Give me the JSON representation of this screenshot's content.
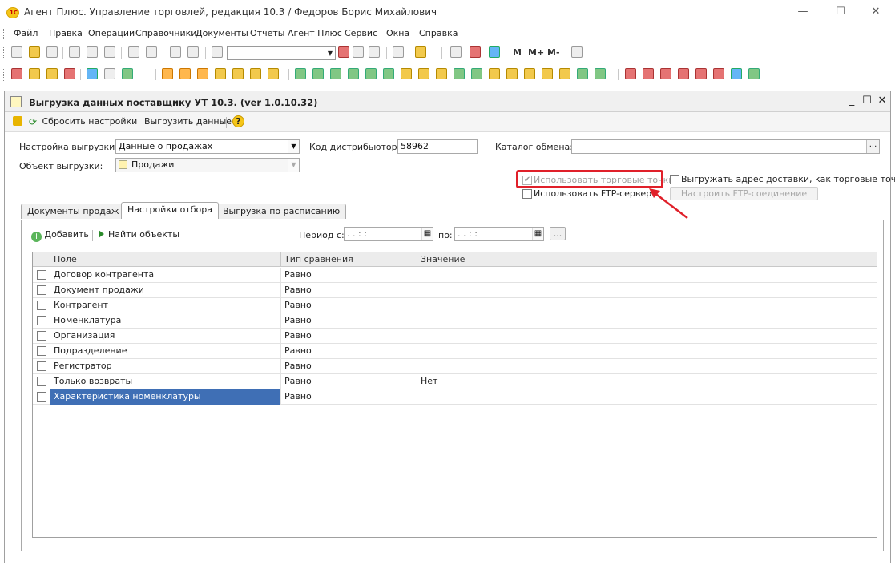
{
  "window": {
    "logo_text": "1С",
    "title": "Агент Плюс. Управление торговлей, редакция 10.3 / Федоров Борис Михайлович",
    "minimize": "—",
    "maximize": "☐",
    "close": "✕"
  },
  "menu": {
    "items": [
      "Файл",
      "Правка",
      "Операции",
      "Справочники",
      "Документы",
      "Отчеты",
      "Агент Плюс",
      "Сервис",
      "Окна",
      "Справка"
    ]
  },
  "toolbar": {
    "m_label": "M",
    "m_plus_label": "M+",
    "m_minus_label": "M-"
  },
  "document": {
    "title": "Выгрузка данных поставщику УТ 10.3. (ver 1.0.10.32)",
    "win_min": "_",
    "win_max": "☐",
    "win_close": "✕",
    "commands": {
      "reset": "Сбросить настройки",
      "export": "Выгрузить данные",
      "help": "?"
    },
    "settings_label": "Настройка выгрузки:",
    "settings_value": "Данные о продажах",
    "distributor_code_label": "Код дистрибьютора:",
    "distributor_code_value": "58962",
    "exchange_catalog_label": "Каталог обмена:",
    "exchange_catalog_value": "",
    "object_label": "Объект выгрузки:",
    "object_value": "Продажи",
    "use_trade_points_label": "Использовать торговые точки",
    "use_trade_points_checked": true,
    "export_delivery_label": "Выгружать адрес доставки, как торговые точки",
    "use_ftp_label": "Использовать FTP-сервер",
    "configure_ftp_label": "Настроить FTP-соединение",
    "tabs": [
      "Документы продаж",
      "Настройки отбора",
      "Выгрузка по расписанию"
    ],
    "filter": {
      "add_label": "Добавить",
      "find_label": "Найти объекты",
      "period_from_label": "Период с:",
      "period_from_value": ". .  : :",
      "period_to_label": "по:",
      "period_to_value": ". .  : :",
      "period_more": "..."
    },
    "grid": {
      "headers": [
        "Поле",
        "Тип сравнения",
        "Значение"
      ],
      "rows": [
        {
          "field": "Договор контрагента",
          "compare": "Равно",
          "value": ""
        },
        {
          "field": "Документ продажи",
          "compare": "Равно",
          "value": ""
        },
        {
          "field": "Контрагент",
          "compare": "Равно",
          "value": ""
        },
        {
          "field": "Номенклатура",
          "compare": "Равно",
          "value": ""
        },
        {
          "field": "Организация",
          "compare": "Равно",
          "value": ""
        },
        {
          "field": "Подразделение",
          "compare": "Равно",
          "value": ""
        },
        {
          "field": "Регистратор",
          "compare": "Равно",
          "value": ""
        },
        {
          "field": "Только возвраты",
          "compare": "Равно",
          "value": "Нет"
        },
        {
          "field": "Характеристика номенклатуры",
          "compare": "Равно",
          "value": ""
        }
      ]
    }
  },
  "colors": {
    "highlight": "#e0202a",
    "selection": "#3f6fb5"
  }
}
